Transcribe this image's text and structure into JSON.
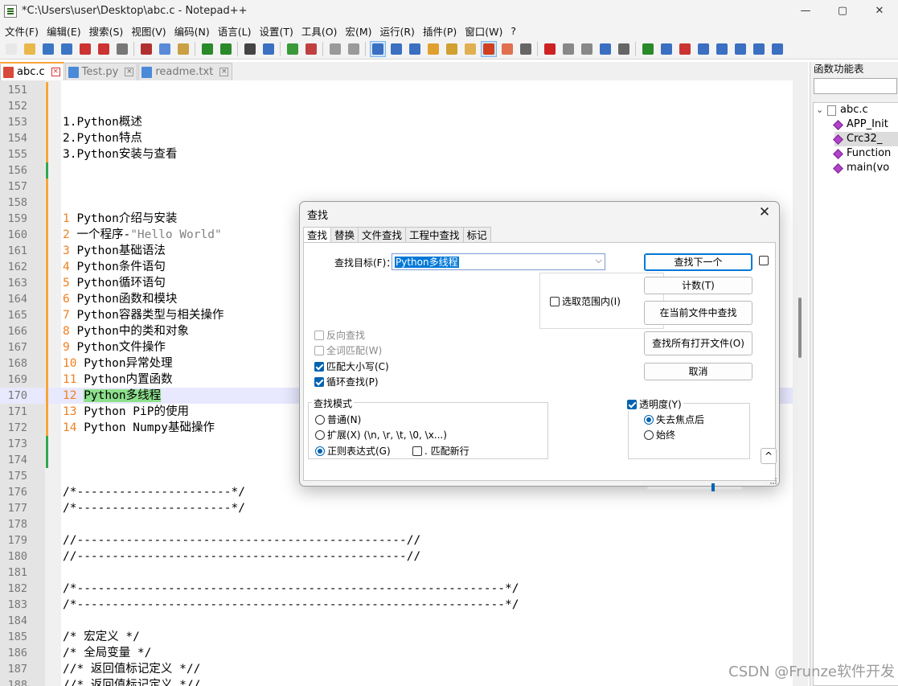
{
  "window": {
    "title": "*C:\\Users\\user\\Desktop\\abc.c - Notepad++",
    "minimize": "—",
    "maximize": "▢",
    "close": "✕"
  },
  "menu": [
    "文件(F)",
    "编辑(E)",
    "搜索(S)",
    "视图(V)",
    "编码(N)",
    "语言(L)",
    "设置(T)",
    "工具(O)",
    "宏(M)",
    "运行(R)",
    "插件(P)",
    "窗口(W)",
    "?"
  ],
  "toolbar_icons": [
    {
      "name": "new-file-icon",
      "color": "#e8e8e8"
    },
    {
      "name": "open-file-icon",
      "color": "#e9b84a"
    },
    {
      "name": "save-icon",
      "color": "#3a76c4"
    },
    {
      "name": "save-all-icon",
      "color": "#3a76c4"
    },
    {
      "name": "close-icon",
      "color": "#cc3333"
    },
    {
      "name": "close-all-icon",
      "color": "#cc3333"
    },
    {
      "name": "print-icon",
      "color": "#777777"
    },
    {
      "name": "sep"
    },
    {
      "name": "cut-icon",
      "color": "#b03030"
    },
    {
      "name": "copy-icon",
      "color": "#5a8ad8"
    },
    {
      "name": "paste-icon",
      "color": "#c9a043"
    },
    {
      "name": "sep"
    },
    {
      "name": "undo-icon",
      "color": "#2a8a2a"
    },
    {
      "name": "redo-icon",
      "color": "#2a8a2a"
    },
    {
      "name": "sep"
    },
    {
      "name": "find-icon",
      "color": "#444444"
    },
    {
      "name": "replace-icon",
      "color": "#3b6fc1"
    },
    {
      "name": "sep"
    },
    {
      "name": "zoom-in-icon",
      "color": "#3a9a3a"
    },
    {
      "name": "zoom-out-icon",
      "color": "#c04040"
    },
    {
      "name": "sep"
    },
    {
      "name": "sync-vertical-icon",
      "color": "#9a9a9a"
    },
    {
      "name": "sync-horizontal-icon",
      "color": "#9a9a9a"
    },
    {
      "name": "sep"
    },
    {
      "name": "word-wrap-icon",
      "color": "#3b6fc1",
      "selected": true
    },
    {
      "name": "show-all-chars-icon",
      "color": "#3b6fc1"
    },
    {
      "name": "indent-guide-icon",
      "color": "#3b6fc1"
    },
    {
      "name": "udl-icon",
      "color": "#e0a030"
    },
    {
      "name": "doc-map-icon",
      "color": "#d0a030"
    },
    {
      "name": "doc-list-icon",
      "color": "#e0b050"
    },
    {
      "name": "function-list-icon",
      "color": "#d04020",
      "selected": true
    },
    {
      "name": "folder-workspace-icon",
      "color": "#e07050"
    },
    {
      "name": "monitoring-icon",
      "color": "#666666"
    },
    {
      "name": "sep"
    },
    {
      "name": "record-macro-icon",
      "color": "#cc2222"
    },
    {
      "name": "stop-macro-icon",
      "color": "#888888"
    },
    {
      "name": "play-macro-icon",
      "color": "#888888"
    },
    {
      "name": "run-macro-multiple-icon",
      "color": "#3b6fc1"
    },
    {
      "name": "save-macro-icon",
      "color": "#666666"
    },
    {
      "name": "sep"
    },
    {
      "name": "download-icon",
      "color": "#2a8a2a"
    },
    {
      "name": "table-icon",
      "color": "#3b6fc1"
    },
    {
      "name": "table-red-icon",
      "color": "#cc3333"
    },
    {
      "name": "collapse-icon",
      "color": "#3b6fc1"
    },
    {
      "name": "arrow-up-icon",
      "color": "#3b6fc1"
    },
    {
      "name": "arrow-down-icon",
      "color": "#3b6fc1"
    },
    {
      "name": "expand-icon",
      "color": "#3b6fc1"
    },
    {
      "name": "grid-icon",
      "color": "#3b6fc1"
    }
  ],
  "tabs": [
    {
      "label": "abc.c",
      "active": true,
      "color": "#d84a3a"
    },
    {
      "label": "Test.py",
      "active": false,
      "color": "#4a8ad8"
    },
    {
      "label": "readme.txt",
      "active": false,
      "color": "#4a8ad8"
    }
  ],
  "editor": {
    "lines": [
      {
        "n": "151",
        "text": "",
        "cls": "",
        "mark": "#f7a43a"
      },
      {
        "n": "152",
        "text": "",
        "cls": "",
        "mark": "#f7a43a"
      },
      {
        "n": "153",
        "text": "1.Python概述",
        "cls": "c-orange",
        "mark": "#f7a43a"
      },
      {
        "n": "154",
        "text": "2.Python特点",
        "cls": "c-orange",
        "mark": "#f7a43a"
      },
      {
        "n": "155",
        "text": "3.Python安装与查看",
        "cls": "c-orange",
        "mark": "#f7a43a"
      },
      {
        "n": "156",
        "text": "",
        "cls": "",
        "mark": "#2fa84f"
      },
      {
        "n": "157",
        "text": "",
        "cls": "",
        "mark": "#f7a43a"
      },
      {
        "n": "158",
        "text": "",
        "cls": "",
        "mark": "#f7a43a"
      },
      {
        "n": "159",
        "text": "1 Python介绍与安装",
        "cls": "",
        "mark": "#f7a43a"
      },
      {
        "n": "160",
        "text": "2 一个程序-",
        "str": "\"Hello World\"",
        "cls": "",
        "mark": "#f7a43a"
      },
      {
        "n": "161",
        "text": "3 Python基础语法",
        "cls": "",
        "mark": "#f7a43a"
      },
      {
        "n": "162",
        "text": "4 Python条件语句",
        "cls": "",
        "mark": "#f7a43a"
      },
      {
        "n": "163",
        "text": "5 Python循环语句",
        "cls": "",
        "mark": "#f7a43a"
      },
      {
        "n": "164",
        "text": "6 Python函数和模块",
        "cls": "",
        "mark": "#f7a43a"
      },
      {
        "n": "165",
        "text": "7 Python容器类型与相关操作",
        "cls": "",
        "mark": "#f7a43a"
      },
      {
        "n": "166",
        "text": "8 Python中的类和对象",
        "cls": "",
        "mark": "#f7a43a"
      },
      {
        "n": "167",
        "text": "9 Python文件操作",
        "cls": "",
        "mark": "#f7a43a"
      },
      {
        "n": "168",
        "text": "10 Python异常处理",
        "cls": "",
        "mark": "#f7a43a"
      },
      {
        "n": "169",
        "text": "11 Python内置函数",
        "cls": "",
        "mark": "#f7a43a"
      },
      {
        "n": "170",
        "prefix": "12 ",
        "hl": "Python多线程",
        "cls": "",
        "mark": "#f7a43a",
        "current": true
      },
      {
        "n": "171",
        "text": "13 Python PiP的使用",
        "cls": "",
        "mark": "#f7a43a"
      },
      {
        "n": "172",
        "text": "14 Python Numpy基础操作",
        "cls": "",
        "mark": "#f7a43a"
      },
      {
        "n": "173",
        "text": "",
        "cls": "",
        "mark": "#2fa84f"
      },
      {
        "n": "174",
        "text": "",
        "cls": "",
        "mark": "#2fa84f"
      },
      {
        "n": "175",
        "text": "",
        "cls": "",
        "mark": ""
      },
      {
        "n": "176",
        "text": "/*----------------------*/",
        "cls": "c-green",
        "mark": ""
      },
      {
        "n": "177",
        "text": "/*----------------------*/",
        "cls": "c-green",
        "mark": ""
      },
      {
        "n": "178",
        "text": "",
        "cls": "",
        "mark": ""
      },
      {
        "n": "179",
        "text": "//-----------------------------------------------//",
        "cls": "c-green",
        "mark": ""
      },
      {
        "n": "180",
        "text": "//-----------------------------------------------//",
        "cls": "c-green",
        "mark": ""
      },
      {
        "n": "181",
        "text": "",
        "cls": "",
        "mark": ""
      },
      {
        "n": "182",
        "text": "/*-------------------------------------------------------------*/",
        "cls": "c-green",
        "mark": ""
      },
      {
        "n": "183",
        "text": "/*-------------------------------------------------------------*/",
        "cls": "c-green",
        "mark": ""
      },
      {
        "n": "184",
        "text": "",
        "cls": "",
        "mark": ""
      },
      {
        "n": "185",
        "text": "/* 宏定义 */",
        "cls": "c-green",
        "mark": ""
      },
      {
        "n": "186",
        "text": "/* 全局变量 */",
        "cls": "c-green",
        "mark": ""
      },
      {
        "n": "187",
        "text": "//* 返回值标记定义 *//",
        "cls": "c-green",
        "mark": ""
      },
      {
        "n": "188",
        "text": "//* 返回值标记定义 *//",
        "cls": "c-green",
        "mark": ""
      }
    ]
  },
  "function_list": {
    "title": "函数功能表",
    "root": "abc.c",
    "expander": "⌄",
    "items": [
      "APP_Init",
      "Crc32_",
      "Function",
      "main(vo"
    ]
  },
  "find_dialog": {
    "title": "查找",
    "close": "✕",
    "tabs": [
      "查找",
      "替换",
      "文件查找",
      "工程中查找",
      "标记"
    ],
    "target_label": "查找目标(F)：",
    "target_value": "Python多线程",
    "combo_arrow": "⌵",
    "buttons": {
      "find_next": "查找下一个",
      "count": "计数(T)",
      "find_in_current": "在当前文件中查找",
      "find_in_all_open": "查找所有打开文件(O)",
      "cancel": "取消",
      "more": "^"
    },
    "in_selection": "选取范围内(I)",
    "options": {
      "backward": "反向查找",
      "whole_word": "全词匹配(W)",
      "match_case": "匹配大小写(C)",
      "wrap_around": "循环查找(P)"
    },
    "search_mode": {
      "label": "查找模式",
      "normal": "普通(N)",
      "extended": "扩展(X) (\\n, \\r, \\t, \\0, \\x...)",
      "regex": "正则表达式(G)",
      "dot_newline": ". 匹配新行"
    },
    "transparency": {
      "label": "透明度(Y)",
      "on_lose_focus": "失去焦点后",
      "always": "始终",
      "level": 0.7
    }
  },
  "watermark": "CSDN @Frunze软件开发"
}
